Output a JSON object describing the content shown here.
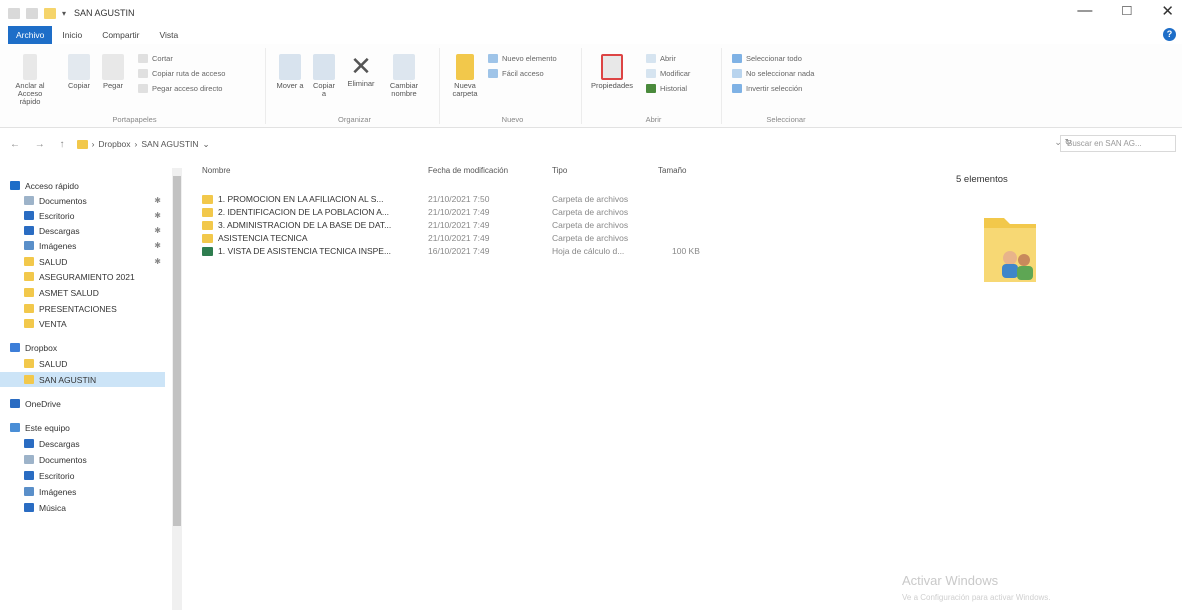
{
  "window": {
    "title": "SAN AGUSTIN",
    "controls": {
      "minimize": "—",
      "maximize": "□",
      "close": "✕"
    }
  },
  "ribbon_tabs": [
    "Archivo",
    "Inicio",
    "Compartir",
    "Vista"
  ],
  "ribbon": {
    "clipboard": {
      "pin_label": "Anclar al Acceso rápido",
      "copy_label": "Copiar",
      "paste_label": "Pegar",
      "cut_label": "Cortar",
      "copy_path_label": "Copiar ruta de acceso",
      "paste_shortcut_label": "Pegar acceso directo",
      "group_label": "Portapapeles"
    },
    "organize": {
      "move_label": "Mover a",
      "copy_to_label": "Copiar a",
      "delete_label": "Eliminar",
      "rename_label": "Cambiar nombre",
      "group_label": "Organizar"
    },
    "new": {
      "new_folder_label": "Nueva carpeta",
      "new_item_label": "Nuevo elemento",
      "easy_access_label": "Fácil acceso",
      "group_label": "Nuevo"
    },
    "open": {
      "properties_label": "Propiedades",
      "open_label": "Abrir",
      "edit_label": "Modificar",
      "history_label": "Historial",
      "group_label": "Abrir"
    },
    "select": {
      "select_all_label": "Seleccionar todo",
      "select_none_label": "No seleccionar nada",
      "invert_label": "Invertir selección",
      "group_label": "Seleccionar"
    }
  },
  "address": {
    "nav_glyphs": "← → ↑",
    "path": [
      "Dropbox",
      "SAN AGUSTIN"
    ],
    "search_placeholder": "Buscar en SAN AG..."
  },
  "sidebar": {
    "items": [
      {
        "label": "Acceso rápido",
        "icon": "star-icon",
        "color": "#1e6ec8",
        "pinned": false
      },
      {
        "label": "Documentos",
        "icon": "documents-icon",
        "color": "#9db3c9",
        "pinned": true
      },
      {
        "label": "Escritorio",
        "icon": "desktop-icon",
        "color": "#2a6cc2",
        "pinned": true
      },
      {
        "label": "Descargas",
        "icon": "download-icon",
        "color": "#2a6cc2",
        "pinned": true
      },
      {
        "label": "Imágenes",
        "icon": "pictures-icon",
        "color": "#5a8fc9",
        "pinned": true
      },
      {
        "label": "SALUD",
        "icon": "folder-icon",
        "color": "#f2c84b",
        "pinned": true
      },
      {
        "label": "ASEGURAMIENTO 2021",
        "icon": "folder-icon",
        "color": "#f2c84b",
        "pinned": false
      },
      {
        "label": "ASMET SALUD",
        "icon": "folder-icon",
        "color": "#f2c84b",
        "pinned": false
      },
      {
        "label": "PRESENTACIONES",
        "icon": "folder-icon",
        "color": "#f2c84b",
        "pinned": false
      },
      {
        "label": "VENTA",
        "icon": "folder-icon",
        "color": "#f2c84b",
        "pinned": false
      },
      {
        "label": "Dropbox",
        "icon": "dropbox-icon",
        "color": "#3d7ed8",
        "pinned": false
      },
      {
        "label": "SALUD",
        "icon": "folder-icon",
        "color": "#f2c84b",
        "pinned": false
      },
      {
        "label": "SAN AGUSTIN",
        "icon": "folder-icon",
        "color": "#f2c84b",
        "pinned": false,
        "selected": true
      },
      {
        "label": "OneDrive",
        "icon": "cloud-icon",
        "color": "#2a6cc2",
        "pinned": false
      },
      {
        "label": "Este equipo",
        "icon": "computer-icon",
        "color": "#4a8ed6",
        "pinned": false
      },
      {
        "label": "Descargas",
        "icon": "download-icon",
        "color": "#2a6cc2",
        "pinned": false
      },
      {
        "label": "Documentos",
        "icon": "documents-icon",
        "color": "#9db3c9",
        "pinned": false
      },
      {
        "label": "Escritorio",
        "icon": "desktop-icon",
        "color": "#2a6cc2",
        "pinned": false
      },
      {
        "label": "Imágenes",
        "icon": "pictures-icon",
        "color": "#5a8fc9",
        "pinned": false
      },
      {
        "label": "Música",
        "icon": "music-icon",
        "color": "#2a6cc2",
        "pinned": false
      }
    ]
  },
  "file_list": {
    "columns": [
      "Nombre",
      "Fecha de modificación",
      "Tipo",
      "Tamaño"
    ],
    "rows": [
      {
        "name": "1. PROMOCION EN LA AFILIACION AL S...",
        "date": "21/10/2021 7:50",
        "type": "Carpeta de archivos",
        "size": "",
        "icon": "folder-icon",
        "color": "#f2c84b"
      },
      {
        "name": "2. IDENTIFICACION DE LA POBLACION A...",
        "date": "21/10/2021 7:49",
        "type": "Carpeta de archivos",
        "size": "",
        "icon": "folder-icon",
        "color": "#f2c84b"
      },
      {
        "name": "3. ADMINISTRACION DE LA BASE DE DAT...",
        "date": "21/10/2021 7:49",
        "type": "Carpeta de archivos",
        "size": "",
        "icon": "folder-icon",
        "color": "#f2c84b"
      },
      {
        "name": "ASISTENCIA TECNICA",
        "date": "21/10/2021 7:49",
        "type": "Carpeta de archivos",
        "size": "",
        "icon": "folder-icon",
        "color": "#f2c84b"
      },
      {
        "name": "1. VISTA DE ASISTENCIA TECNICA INSPE...",
        "date": "16/10/2021 7:49",
        "type": "Hoja de cálculo d...",
        "size": "100 KB",
        "icon": "excel-file-icon",
        "color": "#2e7d4f"
      }
    ]
  },
  "preview": {
    "count_label": "5 elementos"
  },
  "watermark": {
    "line1": "Activar Windows",
    "line2": "Ve a Configuración para activar Windows."
  }
}
